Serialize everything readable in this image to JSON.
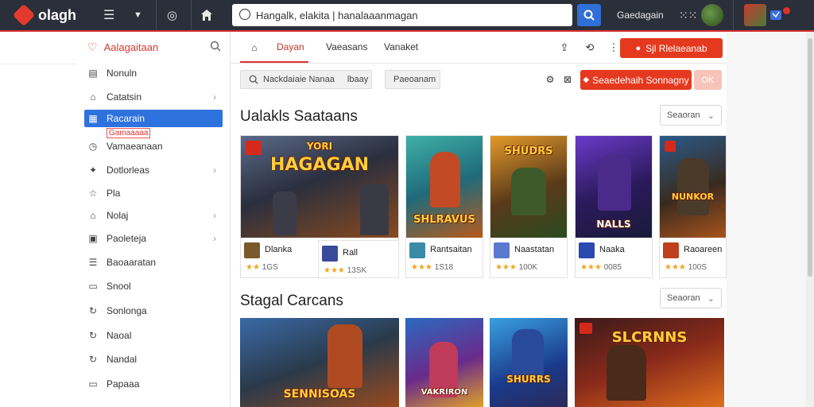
{
  "topbar": {
    "logo": "olagh",
    "search_value": "Hangalk, elakita | hanalaaanmagan",
    "username": "Gaedagain"
  },
  "sidebar": {
    "header": "Aalagaitaan",
    "items": [
      {
        "label": "Nonuln",
        "icon": "chart-icon",
        "chevron": false
      },
      {
        "label": "Catatsin",
        "icon": "tag-icon",
        "chevron": true
      },
      {
        "label": "Racarain",
        "icon": "grid-icon",
        "chevron": false,
        "active": true
      },
      {
        "label": "Vamaeanaan",
        "icon": "clock-icon",
        "chevron": false
      },
      {
        "label": "Dotlorleas",
        "icon": "puzzle-icon",
        "chevron": true
      },
      {
        "label": "Pla",
        "icon": "star-icon",
        "chevron": false
      },
      {
        "label": "Nolaj",
        "icon": "tag-icon",
        "chevron": true
      },
      {
        "label": "Paoleteja",
        "icon": "document-icon",
        "chevron": true
      },
      {
        "label": "Baoaaratan",
        "icon": "list-icon",
        "chevron": false
      },
      {
        "label": "Snool",
        "icon": "document-icon",
        "chevron": false
      },
      {
        "label": "Sonlonga",
        "icon": "refresh-icon",
        "chevron": false
      },
      {
        "label": "Naoal",
        "icon": "refresh-icon",
        "chevron": false
      },
      {
        "label": "Nandal",
        "icon": "refresh-icon",
        "chevron": false
      },
      {
        "label": "Papaaa",
        "icon": "document-icon",
        "chevron": false
      }
    ],
    "badge": "Gamaaaaa"
  },
  "main": {
    "tabs": [
      {
        "label": "Dayan",
        "active": true
      },
      {
        "label": "Vaeasans",
        "active": false
      },
      {
        "label": "Vanaket",
        "active": false
      }
    ],
    "primary_button": "Sjl Rlelaeanab",
    "filter_search": "Nackdaiaie Nanaa",
    "filter_extra": "lbaay",
    "filter_chip": "Paeoanam",
    "action_button": "Seaedehaih Sonnagny",
    "action_button_secondary": "OK",
    "section1_title": "Ualakls Saataans",
    "section2_title": "Stagal Carcans",
    "sort_label": "Seaoran",
    "sort_label_2": "Seaoran",
    "games": [
      {
        "name": "Dlanka",
        "rating": "1GS",
        "stars": "★★",
        "art_title": "HAGAGAN",
        "art_sub": "YORI"
      },
      {
        "name": "Rall",
        "rating": "13SK",
        "stars": "★★★",
        "art_title": ""
      },
      {
        "name": "Rantsaitan",
        "rating": "1S18",
        "stars": "★★★",
        "art_title": "SHLRAVUS"
      },
      {
        "name": "Naastatan",
        "rating": "100K",
        "stars": "★★★",
        "art_title": "SHUDRS"
      },
      {
        "name": "Naaka",
        "rating": "0085",
        "stars": "★★★",
        "art_title": "NALLS"
      },
      {
        "name": "Raoareen",
        "rating": "100S",
        "stars": "★★★",
        "art_title": "NUNKOR"
      }
    ],
    "games2": [
      {
        "art_title": "SENNISOAS"
      },
      {
        "art_title": "VAKRIRON"
      },
      {
        "art_title": "SHURRS"
      },
      {
        "art_title": "SLCRNNS"
      }
    ]
  },
  "colors": {
    "accent_red": "#e5391f",
    "active_blue": "#2e72de",
    "topbar_bg": "#2b2f3a"
  }
}
